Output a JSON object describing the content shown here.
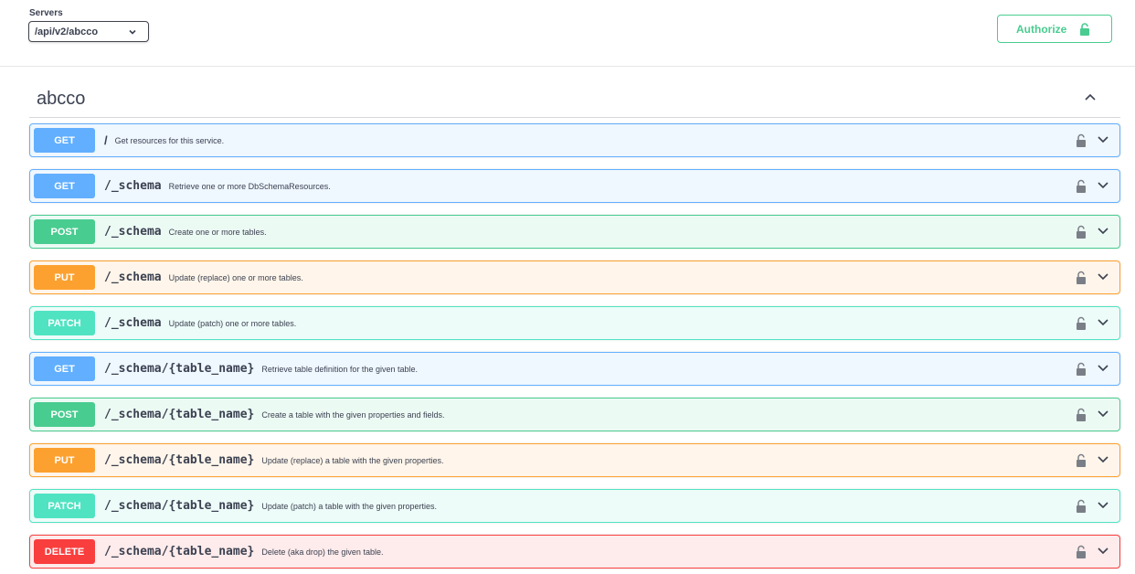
{
  "servers": {
    "label": "Servers",
    "selected": "/api/v2/abcco"
  },
  "authorize": {
    "label": "Authorize",
    "icon": "lock-open-icon"
  },
  "tag": {
    "name": "abcco",
    "toggle_icon": "chevron-up-icon"
  },
  "operations": [
    {
      "method": "GET",
      "path": "/",
      "summary": "Get resources for this service."
    },
    {
      "method": "GET",
      "path": "/_schema",
      "summary": "Retrieve one or more DbSchemaResources."
    },
    {
      "method": "POST",
      "path": "/_schema",
      "summary": "Create one or more tables."
    },
    {
      "method": "PUT",
      "path": "/_schema",
      "summary": "Update (replace) one or more tables."
    },
    {
      "method": "PATCH",
      "path": "/_schema",
      "summary": "Update (patch) one or more tables."
    },
    {
      "method": "GET",
      "path": "/_schema/{table_name}",
      "summary": "Retrieve table definition for the given table."
    },
    {
      "method": "POST",
      "path": "/_schema/{table_name}",
      "summary": "Create a table with the given properties and fields."
    },
    {
      "method": "PUT",
      "path": "/_schema/{table_name}",
      "summary": "Update (replace) a table with the given properties."
    },
    {
      "method": "PATCH",
      "path": "/_schema/{table_name}",
      "summary": "Update (patch) a table with the given properties."
    },
    {
      "method": "DELETE",
      "path": "/_schema/{table_name}",
      "summary": "Delete (aka drop) the given table."
    }
  ],
  "colors": {
    "get": "#61affe",
    "post": "#49cc90",
    "put": "#fca130",
    "patch": "#50e3c2",
    "delete": "#f93e3e"
  }
}
